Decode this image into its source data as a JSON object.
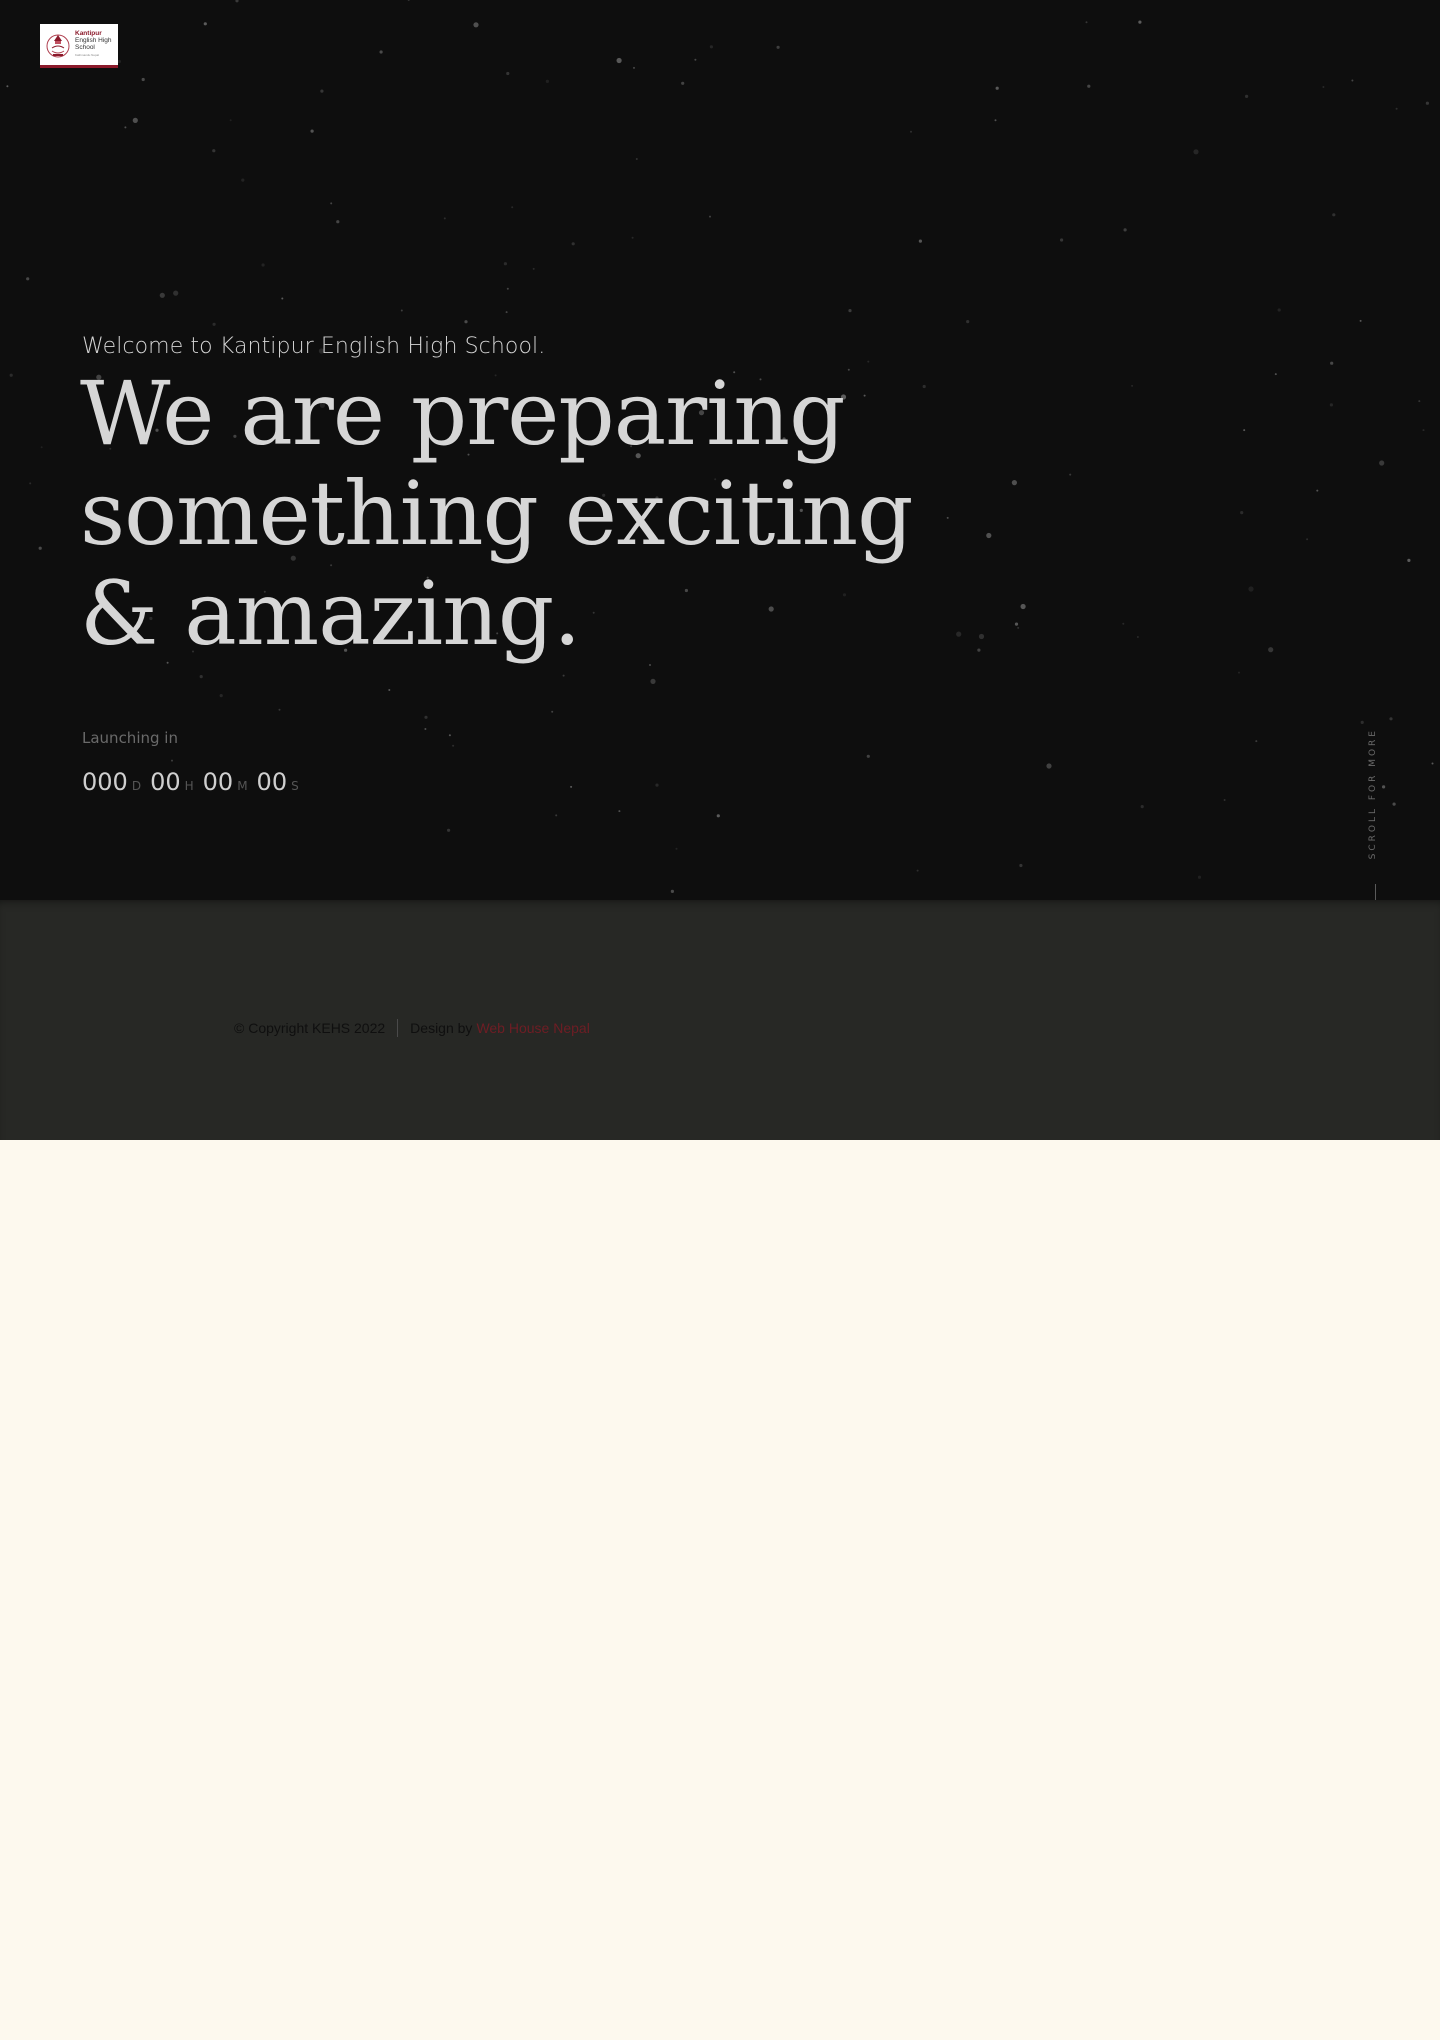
{
  "logo": {
    "line1": "Kantipur",
    "line2": "English High",
    "line3": "School",
    "line4": "Kathmandu Nepal",
    "accent_color": "#8b1a2b",
    "icon": "school-emblem-icon"
  },
  "hero": {
    "welcome": "Welcome to Kantipur English High School.",
    "headline_line1": "We are preparing",
    "headline_line2": "something exciting",
    "headline_line3": "& amazing.",
    "launching_label": "Launching in",
    "background_color": "#0e0e0e"
  },
  "countdown": {
    "days": "000",
    "days_unit": "D",
    "hours": "00",
    "hours_unit": "H",
    "minutes": "00",
    "minutes_unit": "M",
    "seconds": "00",
    "seconds_unit": "S"
  },
  "scroll": {
    "label": "SCROLL FOR MORE"
  },
  "footer": {
    "copyright": "© Copyright KEHS 2022",
    "design_prefix": "Design by",
    "design_link": "Web House Nepal",
    "link_color": "#6e1d24",
    "background_color": "#272825"
  }
}
